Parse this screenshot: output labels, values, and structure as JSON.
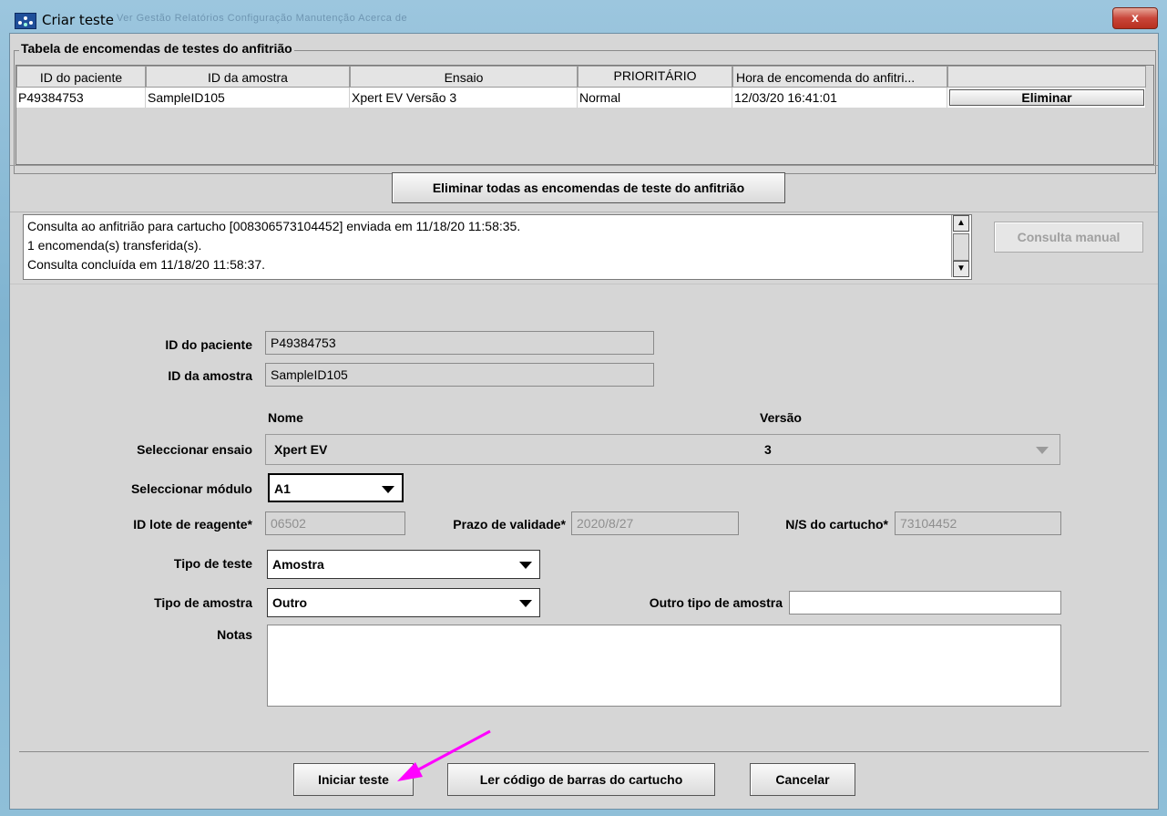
{
  "window": {
    "title": "Criar teste",
    "menu_ghost": "Ver  Gestão    Relatórios    Configuração    Manutenção    Acerca de",
    "close_label": "x"
  },
  "orders_group": {
    "title": "Tabela de encomendas de testes do anfitrião",
    "columns": [
      "ID do paciente",
      "ID da amostra",
      "Ensaio",
      "PRIORITÁRIO",
      "Hora de encomenda do anfitri..."
    ],
    "row": {
      "patient_id": "P49384753",
      "sample_id": "SampleID105",
      "assay": "Xpert EV Versão 3",
      "priority": "Normal",
      "order_time": "12/03/20 16:41:01",
      "delete_label": "Eliminar"
    }
  },
  "delete_all_label": "Eliminar todas as encomendas de teste do anfitrião",
  "log": {
    "lines": [
      "Consulta ao anfitrião para cartucho [008306573104452] enviada em  11/18/20  11:58:35.",
      "1 encomenda(s) transferida(s).",
      "Consulta concluída em  11/18/20 11:58:37."
    ]
  },
  "manual_query_label": "Consulta manual",
  "form": {
    "patient_id_label": "ID do paciente",
    "patient_id_value": "P49384753",
    "sample_id_label": "ID da amostra",
    "sample_id_value": "SampleID105",
    "name_header": "Nome",
    "version_header": "Versão",
    "select_assay_label": "Seleccionar ensaio",
    "assay_name": "Xpert EV",
    "assay_version": "3",
    "select_module_label": "Seleccionar módulo",
    "module_value": "A1",
    "reagent_lot_label": "ID lote de reagente*",
    "reagent_lot_value": "06502",
    "expiry_label": "Prazo de validade*",
    "expiry_value": "2020/8/27",
    "cartridge_sn_label": "N/S do cartucho*",
    "cartridge_sn_value": "73104452",
    "test_type_label": "Tipo de teste",
    "test_type_value": "Amostra",
    "sample_type_label": "Tipo de amostra",
    "sample_type_value": "Outro",
    "other_sample_type_label": "Outro tipo de amostra",
    "other_sample_type_value": "",
    "notes_label": "Notas",
    "notes_value": ""
  },
  "buttons": {
    "start_test": "Iniciar teste",
    "read_barcode": "Ler código de barras do cartucho",
    "cancel": "Cancelar"
  },
  "colors": {
    "annotation_arrow": "#ff00ff"
  }
}
